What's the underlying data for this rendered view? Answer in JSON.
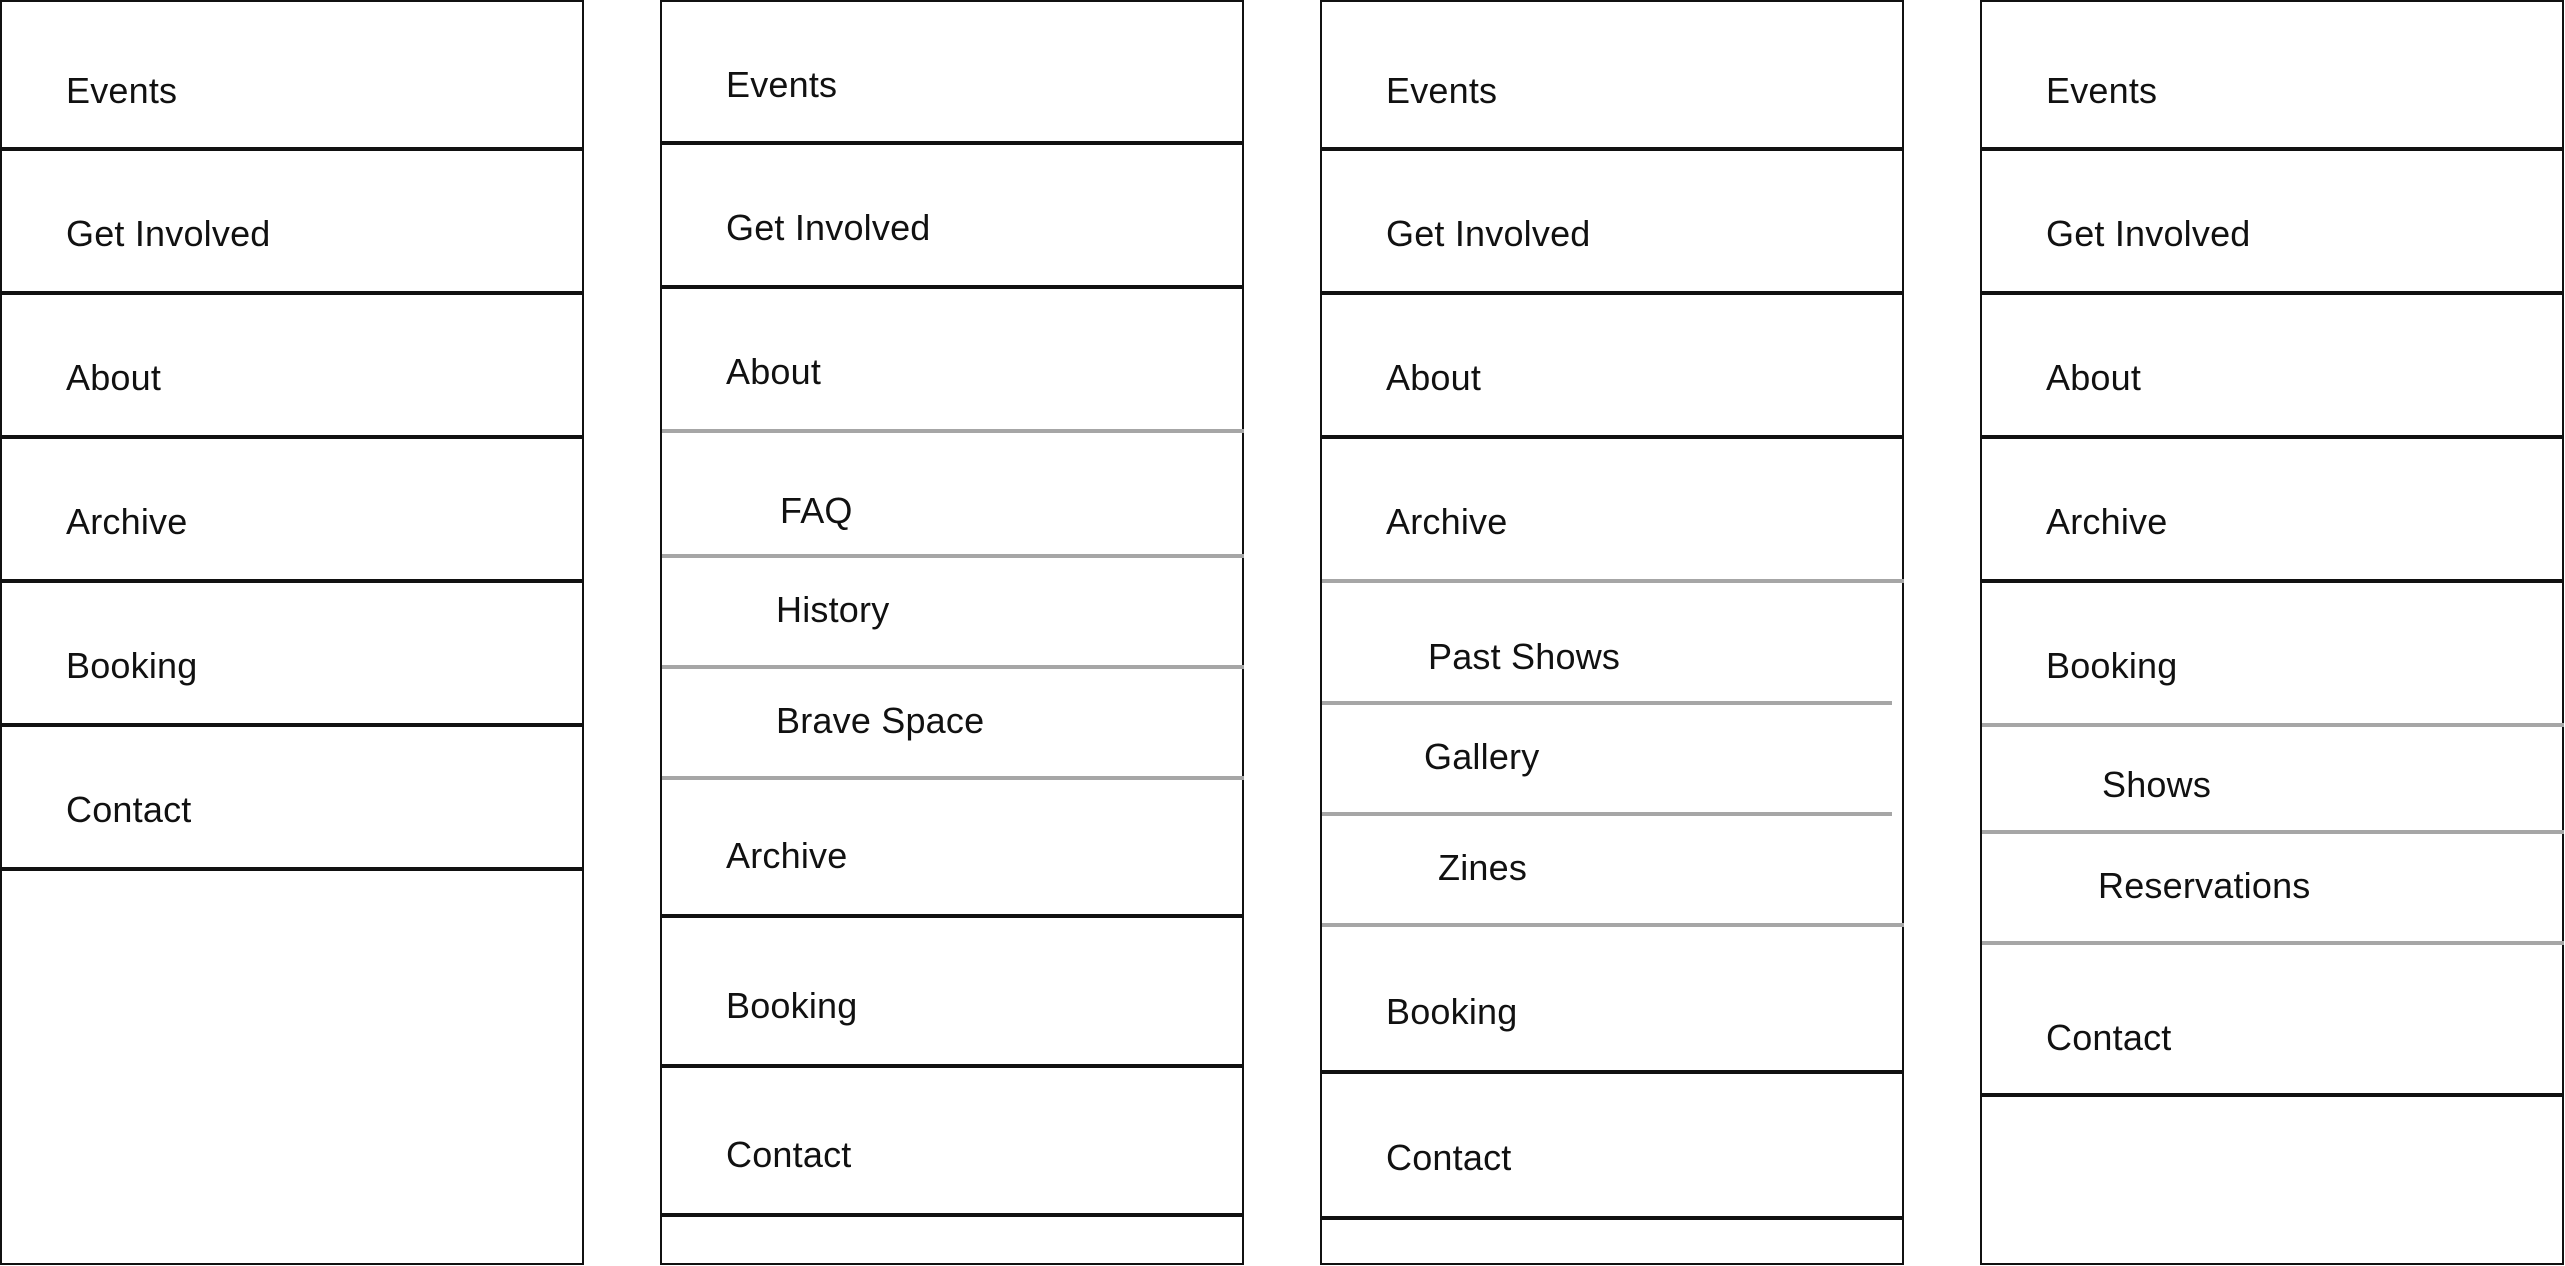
{
  "panels": [
    {
      "items": [
        {
          "label": "Events"
        },
        {
          "label": "Get Involved"
        },
        {
          "label": "About"
        },
        {
          "label": "Archive"
        },
        {
          "label": "Booking"
        },
        {
          "label": "Contact"
        }
      ]
    },
    {
      "items": [
        {
          "label": "Events"
        },
        {
          "label": "Get Involved"
        },
        {
          "label": "About"
        },
        {
          "label": "FAQ"
        },
        {
          "label": "History"
        },
        {
          "label": "Brave Space"
        },
        {
          "label": "Archive"
        },
        {
          "label": "Booking"
        },
        {
          "label": "Contact"
        }
      ]
    },
    {
      "items": [
        {
          "label": "Events"
        },
        {
          "label": "Get Involved"
        },
        {
          "label": "About"
        },
        {
          "label": "Archive"
        },
        {
          "label": "Past Shows"
        },
        {
          "label": "Gallery"
        },
        {
          "label": "Zines"
        },
        {
          "label": "Booking"
        },
        {
          "label": "Contact"
        }
      ]
    },
    {
      "items": [
        {
          "label": "Events"
        },
        {
          "label": "Get Involved"
        },
        {
          "label": "About"
        },
        {
          "label": "Archive"
        },
        {
          "label": "Booking"
        },
        {
          "label": "Shows"
        },
        {
          "label": "Reservations"
        },
        {
          "label": "Contact"
        }
      ]
    }
  ]
}
